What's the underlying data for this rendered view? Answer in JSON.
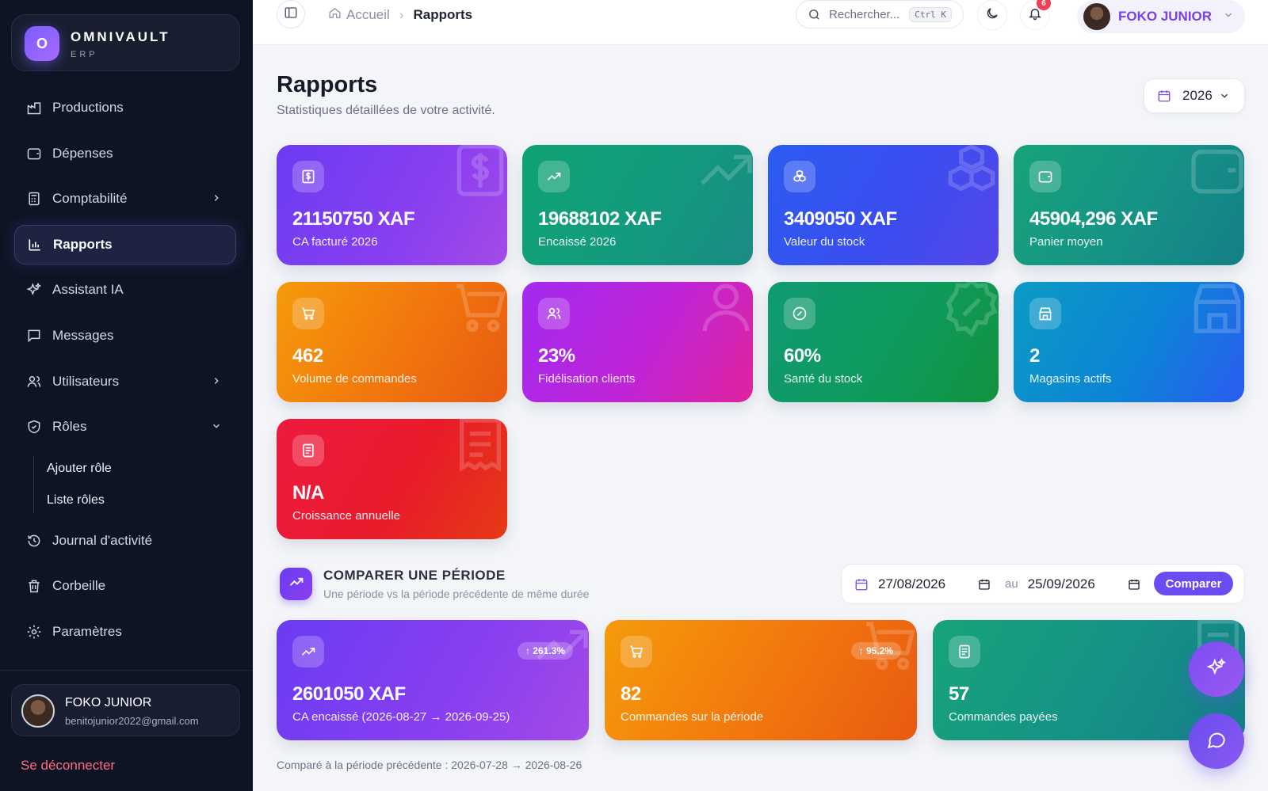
{
  "brand": {
    "name": "OMNIVAULT",
    "sub": "ERP",
    "logo_letter": "O"
  },
  "sidebar": {
    "items": [
      {
        "label": "Productions",
        "icon": "factory-icon"
      },
      {
        "label": "Dépenses",
        "icon": "wallet-icon"
      },
      {
        "label": "Comptabilité",
        "icon": "calculator-icon"
      },
      {
        "label": "Rapports",
        "icon": "bar-chart-icon"
      },
      {
        "label": "Assistant IA",
        "icon": "sparkles-icon"
      },
      {
        "label": "Messages",
        "icon": "message-icon"
      },
      {
        "label": "Utilisateurs",
        "icon": "users-icon"
      },
      {
        "label": "Rôles",
        "icon": "shield-icon"
      }
    ],
    "roles_sub": [
      "Ajouter rôle",
      "Liste rôles"
    ],
    "items_after": [
      {
        "label": "Journal d'activité",
        "icon": "history-icon"
      },
      {
        "label": "Corbeille",
        "icon": "trash-icon"
      },
      {
        "label": "Paramètres",
        "icon": "gear-icon"
      }
    ],
    "user": {
      "name": "FOKO JUNIOR",
      "email": "benitojunior2022@gmail.com"
    },
    "logout": "Se déconnecter"
  },
  "topbar": {
    "breadcrumb_home": "Accueil",
    "breadcrumb_current": "Rapports",
    "search_placeholder": "Rechercher...",
    "search_shortcut": "Ctrl K",
    "notif_count": "6",
    "user_name": "FOKO JUNIOR"
  },
  "page": {
    "title": "Rapports",
    "subtitle": "Statistiques détaillées de votre activité.",
    "year": "2026"
  },
  "kpis": [
    {
      "value": "21150750 XAF",
      "label": "CA facturé 2026",
      "icon": "dollar-icon"
    },
    {
      "value": "19688102 XAF",
      "label": "Encaissé 2026",
      "icon": "trending-up-icon"
    },
    {
      "value": "3409050 XAF",
      "label": "Valeur du stock",
      "icon": "boxes-icon"
    },
    {
      "value": "45904,296 XAF",
      "label": "Panier moyen",
      "icon": "wallet-icon"
    },
    {
      "value": "462",
      "label": "Volume de commandes",
      "icon": "cart-icon"
    },
    {
      "value": "23%",
      "label": "Fidélisation clients",
      "icon": "users-icon"
    },
    {
      "value": "60%",
      "label": "Santé du stock",
      "icon": "badge-percent-icon"
    },
    {
      "value": "2",
      "label": "Magasins actifs",
      "icon": "store-icon"
    },
    {
      "value": "N/A",
      "label": "Croissance annuelle",
      "icon": "receipt-icon"
    }
  ],
  "compare": {
    "title": "COMPARER UNE PÉRIODE",
    "subtitle": "Une période vs la période précédente de même durée",
    "from": "27/08/2026",
    "au": "au",
    "to": "25/09/2026",
    "button": "Comparer",
    "cards": [
      {
        "value": "2601050 XAF",
        "label": "CA encaissé (2026-08-27 → 2026-09-25)",
        "pct": "↑ 261.3%",
        "icon": "trending-up-icon"
      },
      {
        "value": "82",
        "label": "Commandes sur la période",
        "pct": "↑ 95.2%",
        "icon": "cart-icon"
      },
      {
        "value": "57",
        "label": "Commandes payées",
        "pct": "",
        "icon": "receipt-icon"
      }
    ],
    "footnote": "Comparé à la période précédente : 2026-07-28 → 2026-08-26"
  }
}
